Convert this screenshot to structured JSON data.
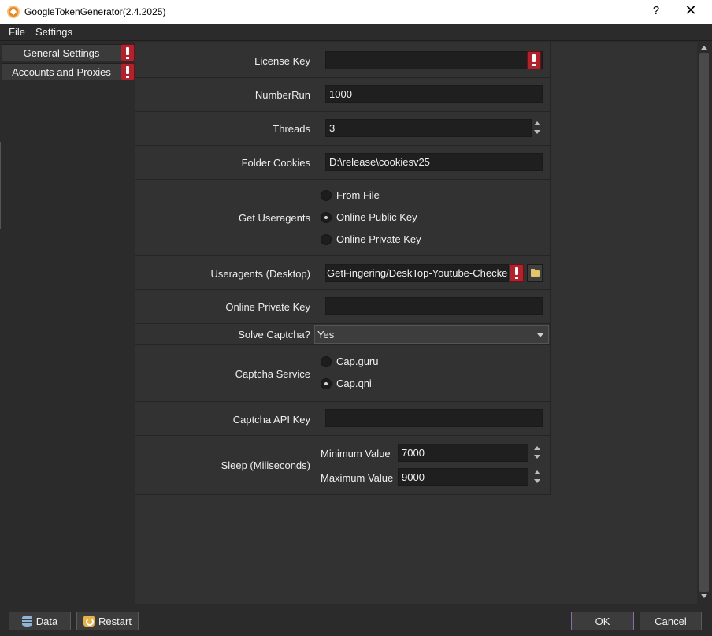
{
  "window": {
    "title": "GoogleTokenGenerator(2.4.2025)",
    "help": "?",
    "close": "✕"
  },
  "menu": {
    "file": "File",
    "settings": "Settings"
  },
  "sidebar": {
    "items": [
      {
        "label": "General Settings",
        "has_warning": true
      },
      {
        "label": "Accounts and Proxies",
        "has_warning": true
      }
    ]
  },
  "form": {
    "license_key": {
      "label": "License Key",
      "value": ""
    },
    "number_run": {
      "label": "NumberRun",
      "value": "1000"
    },
    "threads": {
      "label": "Threads",
      "value": "3"
    },
    "folder_cookies": {
      "label": "Folder Cookies",
      "value": "D:\\release\\cookiesv25"
    },
    "get_useragents": {
      "label": "Get Useragents",
      "options": [
        "From File",
        "Online Public Key",
        "Online Private Key"
      ],
      "selected": "Online Public Key"
    },
    "useragents_desktop": {
      "label": "Useragents (Desktop)",
      "value": "GetFingering/DeskTop-Youtube-Checked."
    },
    "online_private_key": {
      "label": "Online Private Key",
      "value": ""
    },
    "solve_captcha": {
      "label": "Solve Captcha?",
      "value": "Yes"
    },
    "captcha_service": {
      "label": "Captcha Service",
      "options": [
        "Cap.guru",
        "Cap.qni"
      ],
      "selected": "Cap.qni"
    },
    "captcha_api_key": {
      "label": "Captcha API Key",
      "value": ""
    },
    "sleep": {
      "label": "Sleep (Miliseconds)",
      "min_label": "Minimum Value",
      "min_value": "7000",
      "max_label": "Maximum Value",
      "max_value": "9000"
    }
  },
  "buttons": {
    "data": "Data",
    "restart": "Restart",
    "ok": "OK",
    "cancel": "Cancel"
  },
  "icons": {
    "app": "app-logo-icon",
    "warning": "warning-icon",
    "folder": "folder-icon",
    "database": "database-icon",
    "restart": "restart-icon"
  },
  "colors": {
    "warning": "#b0232c",
    "ok_border": "#8c6bb0",
    "background": "#323232"
  }
}
